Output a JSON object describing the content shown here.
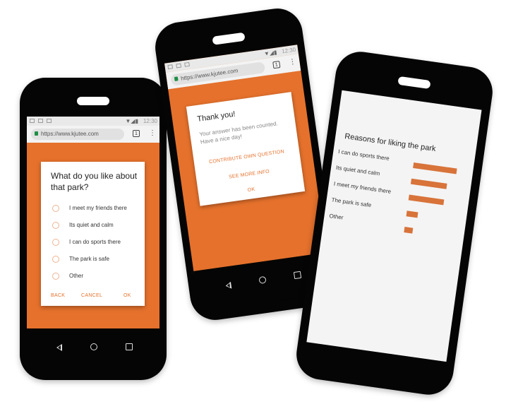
{
  "phone_left": {
    "status": {
      "clock": "12:30",
      "signal": "▼◢▮"
    },
    "url": "https://www.kjutee.com",
    "tab_count": "1",
    "question": "What do you like about that park?",
    "options": [
      "I meet my friends there",
      "Its quiet and calm",
      "I can do sports there",
      "The park is safe",
      "Other"
    ],
    "actions": {
      "back": "BACK",
      "cancel": "CANCEL",
      "ok": "OK"
    }
  },
  "phone_middle": {
    "status": {
      "clock": "12:30",
      "signal": "▼◢▮"
    },
    "url": "https://www.kjutee.com",
    "tab_count": "1",
    "title": "Thank you!",
    "message": "Your answer has been counted. Have a nice day!",
    "actions": {
      "contribute": "CONTRIBUTE OWN QUESTION",
      "more_info": "SEE MORE INFO",
      "ok": "OK"
    }
  },
  "phone_right": {
    "chart_data": {
      "type": "bar",
      "title": "Reasons for liking the park",
      "categories": [
        "I can do sports there",
        "Its quiet and calm",
        "I meet my friends there",
        "The park is safe",
        "Other"
      ],
      "values": [
        100,
        82,
        80,
        26,
        20
      ],
      "bar_color": "#d8733a"
    }
  },
  "colors": {
    "accent": "#e5712c",
    "phone_body": "#050505"
  }
}
